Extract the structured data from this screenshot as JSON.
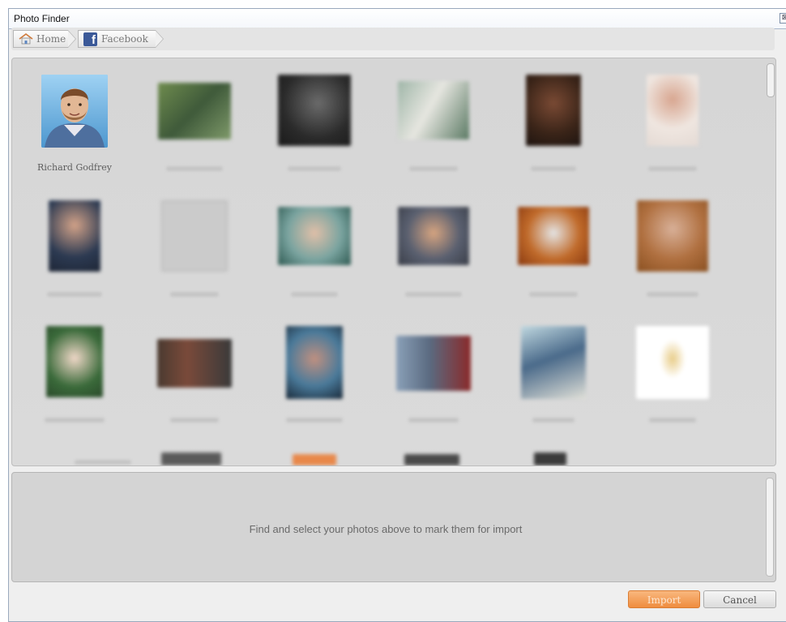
{
  "window": {
    "title": "Photo Finder",
    "close_glyph": "⊠"
  },
  "breadcrumb": {
    "items": [
      {
        "label": "Home",
        "icon": "home-icon"
      },
      {
        "label": "Facebook",
        "icon": "facebook-icon"
      }
    ]
  },
  "gallery": {
    "friends": [
      {
        "name": "Richard Godfrey"
      }
    ]
  },
  "selection_panel": {
    "message": "Find and select your photos above to mark them for import"
  },
  "footer": {
    "import_label": "Import",
    "cancel_label": "Cancel"
  },
  "colors": {
    "accent": "#ef8d3f",
    "facebook": "#3b5998"
  }
}
